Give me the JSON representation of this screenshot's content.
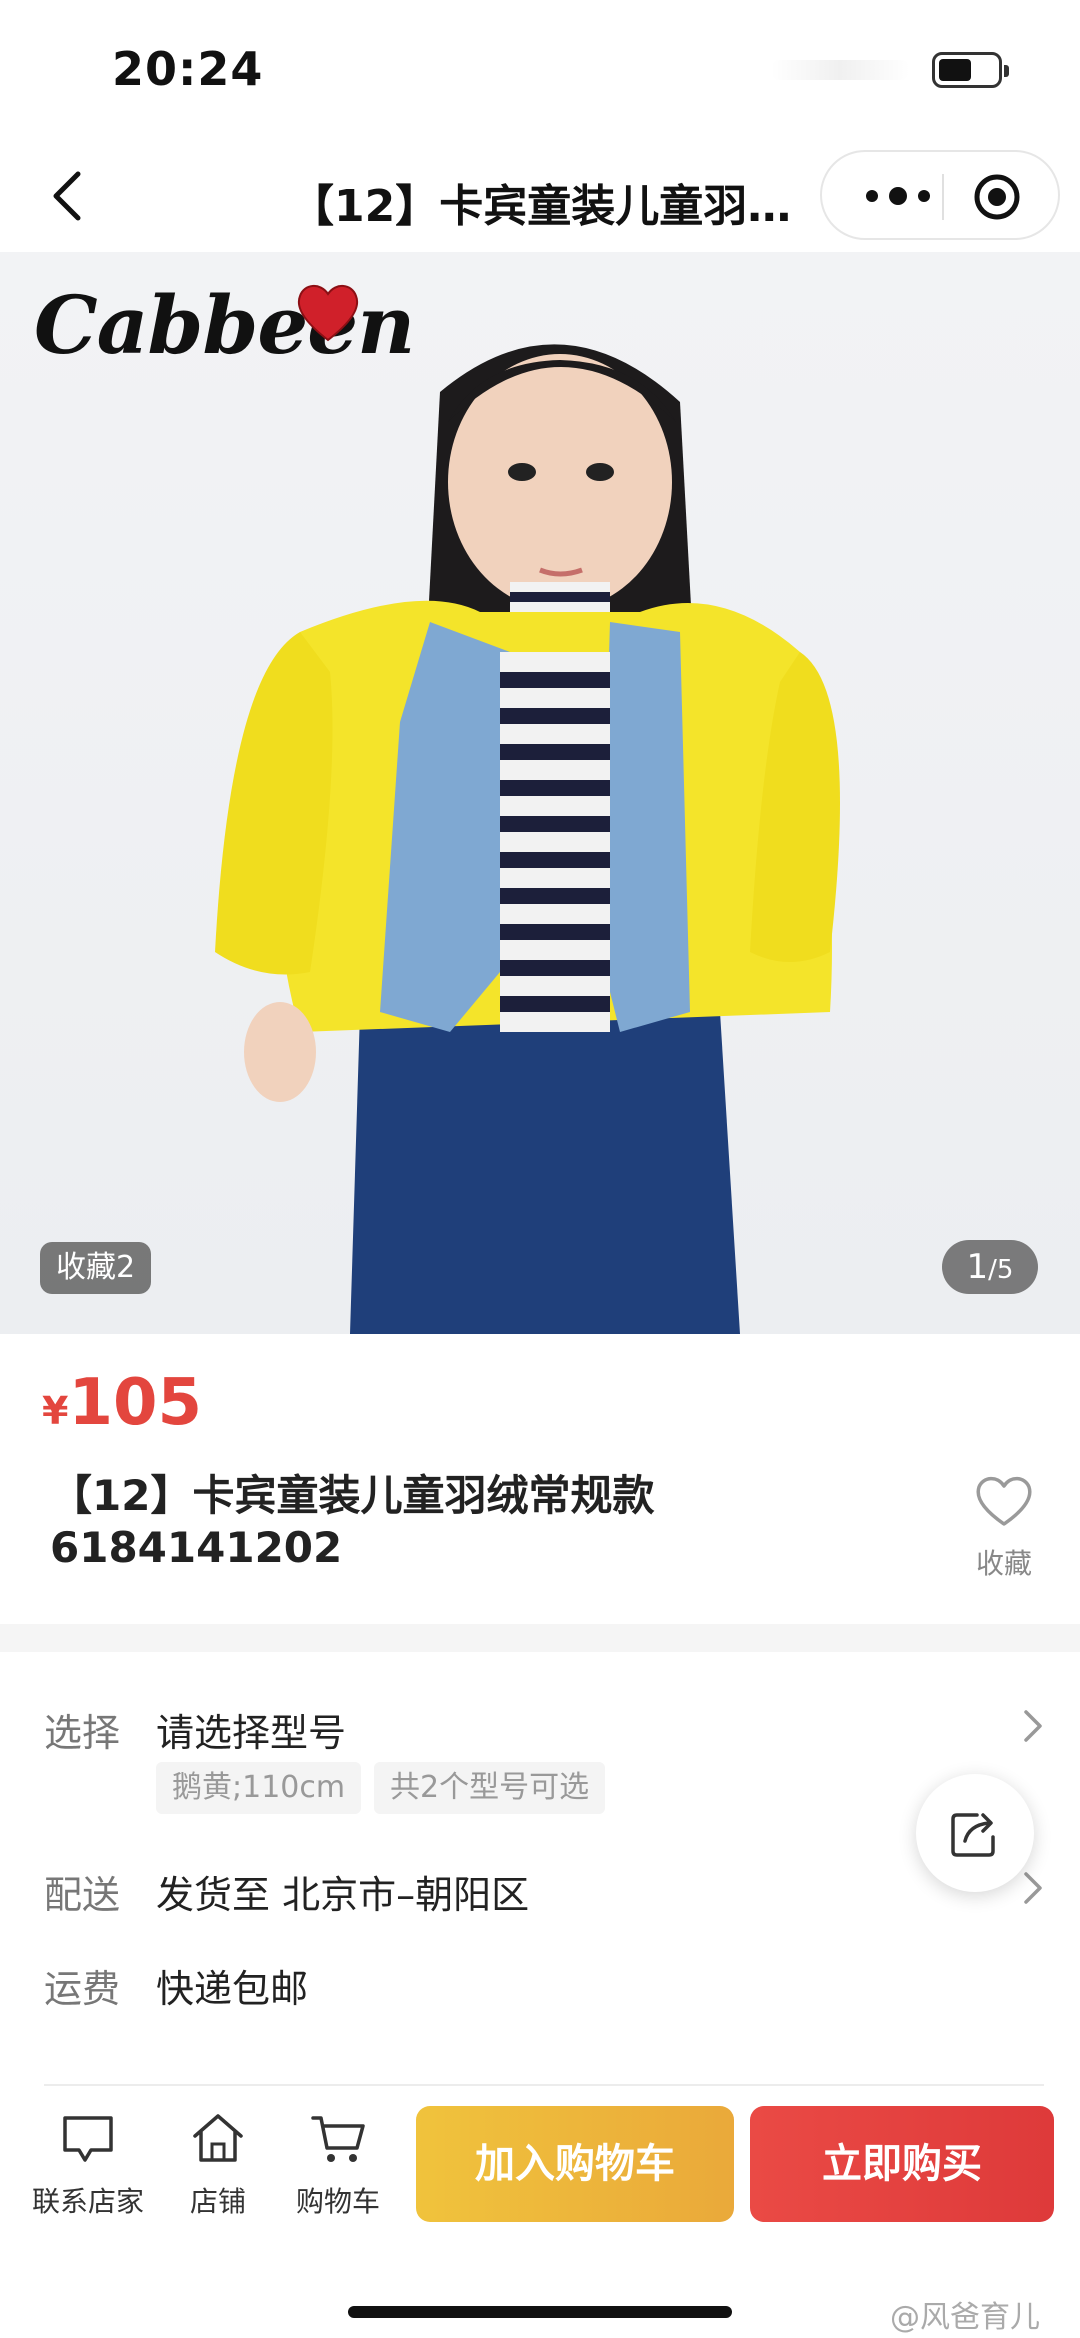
{
  "status_bar": {
    "time": "20:24"
  },
  "nav": {
    "title": "【12】卡宾童装儿童羽…"
  },
  "hero": {
    "brand_logo": "Cabbeen",
    "fav_chip": "收藏2",
    "counter_current": "1",
    "counter_total": "/5"
  },
  "product": {
    "currency": "¥",
    "price": "105",
    "title": "【12】卡宾童装儿童羽绒常规款6184141202",
    "fav_label": "收藏"
  },
  "options": {
    "select_label": "选择",
    "select_value": "请选择型号",
    "tags": [
      "鹅黄;110cm",
      "共2个型号可选"
    ],
    "delivery_label": "配送",
    "delivery_value": "发货至 北京市–朝阳区",
    "shipping_label": "运费",
    "shipping_value": "快递包邮"
  },
  "bottom_bar": {
    "contact_label": "联系店家",
    "shop_label": "店铺",
    "cart_label": "购物车",
    "add_cart_button": "加入购物车",
    "buy_now_button": "立即购买"
  },
  "watermark": "@风爸育儿",
  "colors": {
    "price_red": "#e3463e",
    "cart_yellow": "#f0c33c",
    "buy_red": "#e44440",
    "jacket_yellow": "#f4e42a"
  }
}
